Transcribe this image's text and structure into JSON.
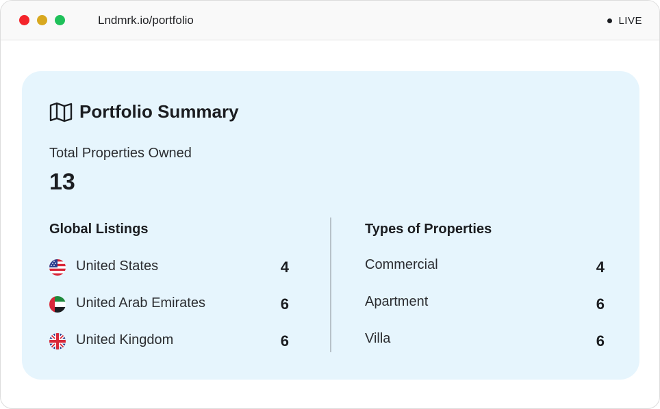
{
  "browser": {
    "url": "Lndmrk.io/portfolio",
    "live_label": "LIVE",
    "dot_colors": [
      "#f4242b",
      "#d8a81f",
      "#1fc15a"
    ]
  },
  "summary": {
    "title": "Portfolio Summary",
    "title_icon": "map-icon",
    "total_label": "Total Properties Owned",
    "total_value": "13"
  },
  "global_listings": {
    "title": "Global Listings",
    "items": [
      {
        "flag": "us-flag-icon",
        "name": "United States",
        "count": "4"
      },
      {
        "flag": "uae-flag-icon",
        "name": "United Arab Emirates",
        "count": "6"
      },
      {
        "flag": "uk-flag-icon",
        "name": "United Kingdom",
        "count": "6"
      }
    ]
  },
  "property_types": {
    "title": "Types of Properties",
    "items": [
      {
        "name": "Commercial",
        "count": "4"
      },
      {
        "name": "Apartment",
        "count": "6"
      },
      {
        "name": "Villa",
        "count": "6"
      }
    ]
  },
  "colors": {
    "card_background": "#e6f5fd",
    "divider": "#b7c2c9",
    "text": "#1b1d21"
  }
}
